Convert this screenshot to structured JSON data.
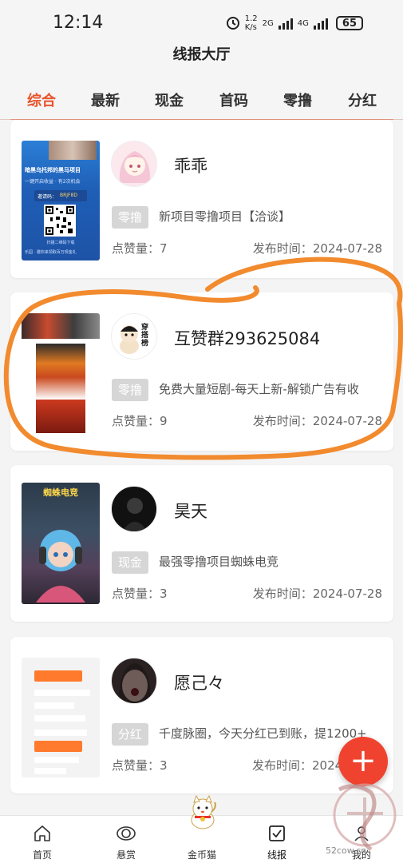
{
  "status": {
    "time": "12:14",
    "net_speed_value": "1.2",
    "net_speed_unit": "K/s",
    "net1": "2G",
    "net2": "4G",
    "battery": "65"
  },
  "header": {
    "title": "线报大厅"
  },
  "tabs": [
    {
      "label": "综合",
      "active": true
    },
    {
      "label": "最新"
    },
    {
      "label": "现金"
    },
    {
      "label": "首码"
    },
    {
      "label": "零撸"
    },
    {
      "label": "分红"
    }
  ],
  "posts": [
    {
      "user": "乖乖",
      "tag": "零撸",
      "desc": "新项目零撸项目【洽谈】",
      "likes_label": "点赞量：",
      "likes": "7",
      "time_label": "发布时间：",
      "time": "2024-07-28",
      "thumb": {
        "line1": "暗黑乌托邦的黑马项目",
        "line2": "一键开启收益 · 有2次机会",
        "code_label": "邀请码：",
        "code": "BRJF8D",
        "footer1": "扫描二维码下载",
        "footer2": "乐园 · 邀你来领取百万现金礼"
      }
    },
    {
      "user": "互赞群293625084",
      "tag": "零撸",
      "desc": "免费大量短剧-每天上新-解锁广告有收",
      "likes_label": "点赞量：",
      "likes": "9",
      "time_label": "发布时间：",
      "time": "2024-07-28",
      "avatar_text": "穿搭榜"
    },
    {
      "user": "昊天",
      "tag": "现金",
      "desc": "最强零撸项目蜘蛛电竞",
      "likes_label": "点赞量：",
      "likes": "3",
      "time_label": "发布时间：",
      "time": "2024-07-28",
      "thumb": {
        "title": "蜘蛛电竞"
      }
    },
    {
      "user": "愿己々",
      "tag": "分红",
      "desc": "千度脉圈，今天分红已到账，提1200+",
      "likes_label": "点赞量：",
      "likes": "3",
      "time_label": "发布时间：",
      "time": "2024"
    }
  ],
  "fab": {
    "glyph": "+"
  },
  "nav": [
    {
      "label": "首页",
      "icon": "home-icon"
    },
    {
      "label": "悬赏",
      "icon": "eye-icon"
    },
    {
      "label": "金币猫",
      "icon": "lucky-cat-icon"
    },
    {
      "label": "线报",
      "icon": "checkbox-icon",
      "active": true
    },
    {
      "label": "我的",
      "icon": "user-icon"
    }
  ],
  "watermark": {
    "text": "52cow.cn"
  },
  "colors": {
    "accent": "#e8532a",
    "fab": "#f0432f",
    "annotation": "#f28a2e",
    "tag_bg": "#d6d6d6"
  }
}
